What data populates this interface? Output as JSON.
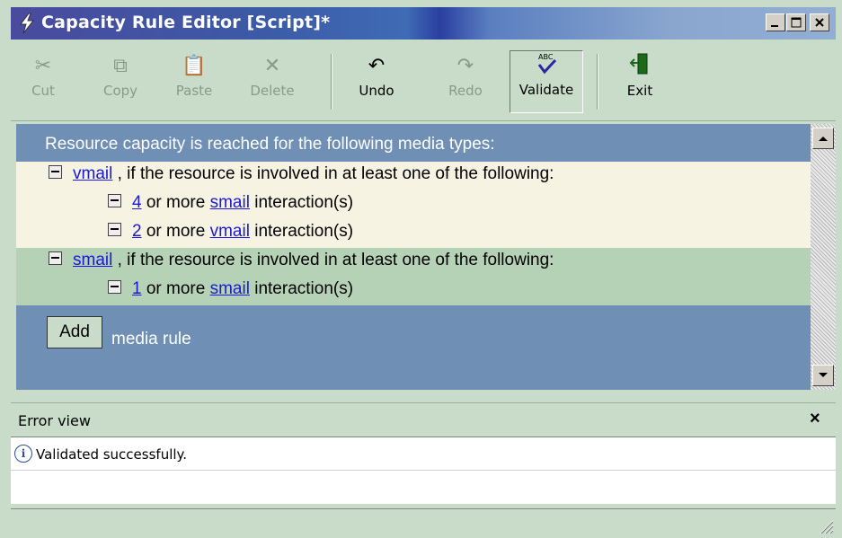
{
  "window": {
    "title": "Capacity Rule Editor [Script]*",
    "icon": "lightning-icon"
  },
  "toolbar": {
    "items": [
      {
        "label": "Cut",
        "icon": "scissors-icon",
        "enabled": false
      },
      {
        "label": "Copy",
        "icon": "copy-icon",
        "enabled": false
      },
      {
        "label": "Paste",
        "icon": "paste-icon",
        "enabled": false
      },
      {
        "label": "Delete",
        "icon": "delete-x-icon",
        "enabled": false
      },
      {
        "label": "Undo",
        "icon": "undo-arrow-icon",
        "enabled": true
      },
      {
        "label": "Redo",
        "icon": "redo-arrow-icon",
        "enabled": false
      },
      {
        "label": "Validate",
        "icon": "abc-check-icon",
        "enabled": true,
        "pressed": true
      },
      {
        "label": "Exit",
        "icon": "exit-door-icon",
        "enabled": true
      }
    ]
  },
  "rules": {
    "header": "Resource capacity is reached for the following media types:",
    "media1": {
      "name": "vmail",
      "suffix": ", if the resource is involved in at least one of the following:",
      "conditions": [
        {
          "count": "4",
          "mid": "or more",
          "media": "smail",
          "end": "interaction(s)"
        },
        {
          "count": "2",
          "mid": "or more",
          "media": "vmail",
          "end": "interaction(s)"
        }
      ]
    },
    "media2": {
      "name": "smail",
      "suffix": ", if the resource is involved in at least one of the following:",
      "conditions": [
        {
          "count": "1",
          "mid": "or more",
          "media": "smail",
          "end": "interaction(s)"
        }
      ]
    },
    "add_button": "Add",
    "add_label": "media rule"
  },
  "error_view": {
    "title": "Error view",
    "close": "×",
    "message": "Validated successfully.",
    "icon": "info-icon"
  },
  "colors": {
    "rule_background": "#6f8fb5",
    "row_cream": "#f6f3e3",
    "row_green": "#b6d2b6",
    "link": "#1a1ad6",
    "chrome": "#c9dcc9"
  }
}
